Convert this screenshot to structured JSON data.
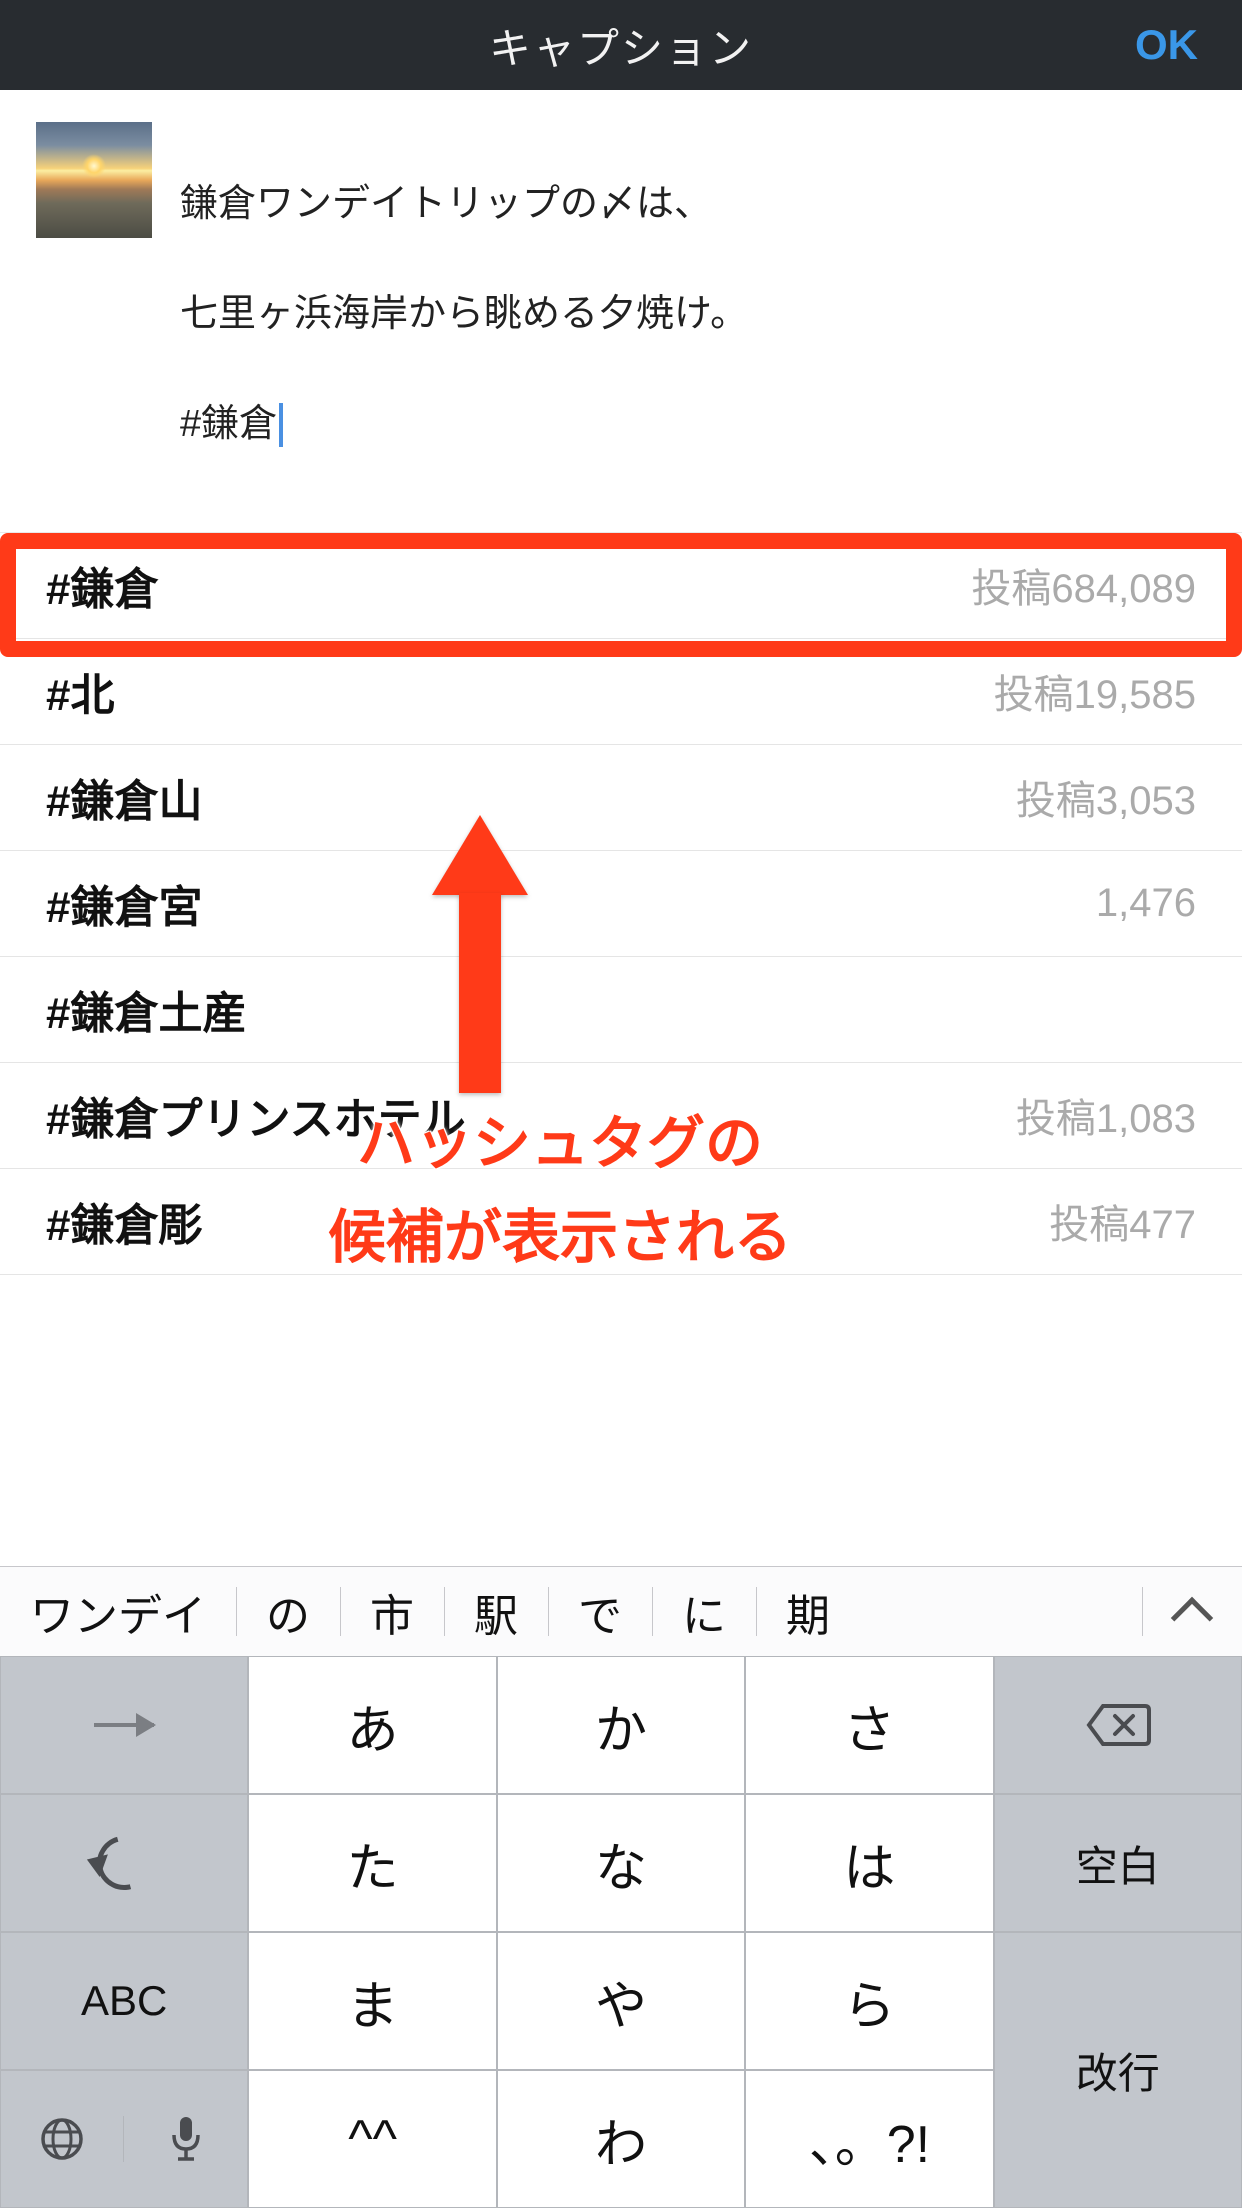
{
  "header": {
    "title": "キャプション",
    "ok": "OK"
  },
  "caption": {
    "line1": "鎌倉ワンデイトリップの〆は、",
    "line2": "七里ヶ浜海岸から眺める夕焼け。",
    "line3": "#鎌倉"
  },
  "suggestions": [
    {
      "tag": "#鎌倉",
      "count": "投稿684,089"
    },
    {
      "tag": "#北",
      "count": "投稿19,585"
    },
    {
      "tag": "#鎌倉山",
      "count": "投稿3,053"
    },
    {
      "tag": "#鎌倉宮",
      "count": "1,476"
    },
    {
      "tag": "#鎌倉土産",
      "count": ""
    },
    {
      "tag": "#鎌倉プリンスホテル",
      "count": "投稿1,083"
    },
    {
      "tag": "#鎌倉彫",
      "count": "投稿477"
    }
  ],
  "annotation": {
    "line1": "ハッシュタグの",
    "line2": "候補が表示される"
  },
  "predict": [
    "ワンデイ",
    "の",
    "市",
    "駅",
    "で",
    "に",
    "期"
  ],
  "keys": {
    "r1": [
      "あ",
      "か",
      "さ"
    ],
    "r2": [
      "た",
      "な",
      "は"
    ],
    "r3": [
      "ま",
      "や",
      "ら"
    ],
    "r4": [
      "^^",
      "わ",
      "、。?!"
    ],
    "abc": "ABC",
    "space": "空白",
    "enter": "改行"
  }
}
